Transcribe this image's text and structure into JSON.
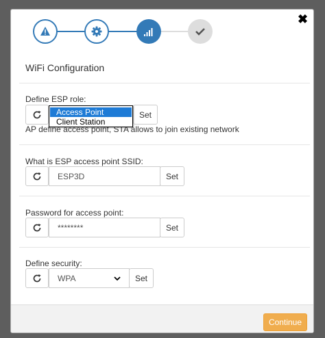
{
  "dialog": {
    "close_glyph": "✖",
    "title": "WiFi Configuration"
  },
  "stepper": {
    "steps": [
      {
        "icon": "warning-icon",
        "state": "done"
      },
      {
        "icon": "gear-icon",
        "state": "done"
      },
      {
        "icon": "signal-icon",
        "state": "active"
      },
      {
        "icon": "check-icon",
        "state": "todo"
      }
    ],
    "colors": {
      "active": "#337ab7",
      "todo": "#dddddd"
    }
  },
  "esp_role": {
    "label": "Define ESP role:",
    "options": [
      "Access Point",
      "Client Station"
    ],
    "selected": "Access Point",
    "set_label": "Set",
    "help": "AP define access point, STA allows to join existing network"
  },
  "ssid": {
    "label": "What is ESP access point SSID:",
    "value": "ESP3D",
    "set_label": "Set"
  },
  "password": {
    "label": "Password for access point:",
    "value": "********",
    "set_label": "Set"
  },
  "security": {
    "label": "Define security:",
    "value": "WPA",
    "set_label": "Set"
  },
  "footer": {
    "continue_label": "Continue",
    "continue_color": "#f0ad4e"
  }
}
